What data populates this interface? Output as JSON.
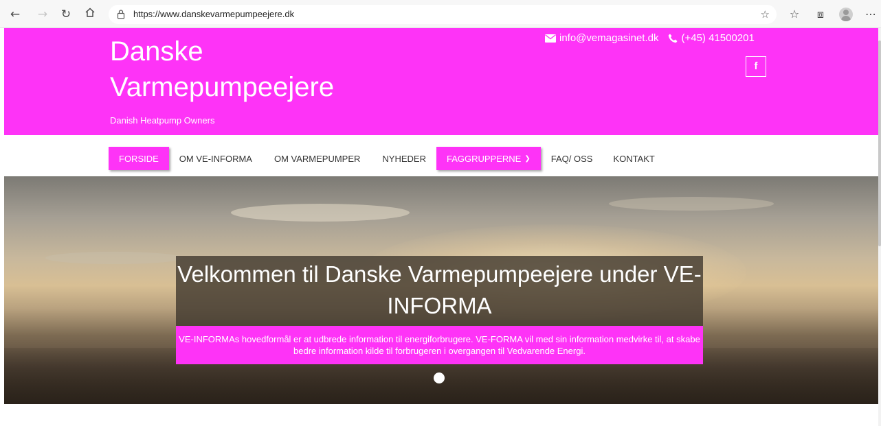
{
  "browser": {
    "url": "https://www.danskevarmepumpeejere.dk",
    "icons": [
      "back-icon",
      "forward-icon",
      "refresh-icon",
      "home-icon",
      "lock-icon",
      "favorite-star-icon",
      "favorites-icon",
      "collections-icon",
      "profile-icon",
      "more-icon"
    ]
  },
  "header": {
    "title": "Danske Varmepumpeejere",
    "tagline": "Danish Heatpump Owners",
    "email": "info@vemagasinet.dk",
    "phone": "(+45) 41500201",
    "facebook_label": "f",
    "accent_color": "#fe33f7"
  },
  "nav": {
    "items": [
      {
        "label": "FORSIDE"
      },
      {
        "label": "OM VE-INFORMA"
      },
      {
        "label": "OM VARMEPUMPER"
      },
      {
        "label": "NYHEDER"
      },
      {
        "label": "FAGGRUPPERNE"
      },
      {
        "label": "FAQ/ OSS"
      },
      {
        "label": "KONTAKT"
      }
    ]
  },
  "hero": {
    "title": "Velkommen til Danske Varmepumpeejere under VE-INFORMA",
    "subtitle": "VE-INFORMAs hovedformål er at udbrede information til energiforbrugere. VE-FORMA vil med sin information medvirke til, at skabe bedre information kilde til forbrugeren i overgangen til Vedvarende Energi."
  }
}
